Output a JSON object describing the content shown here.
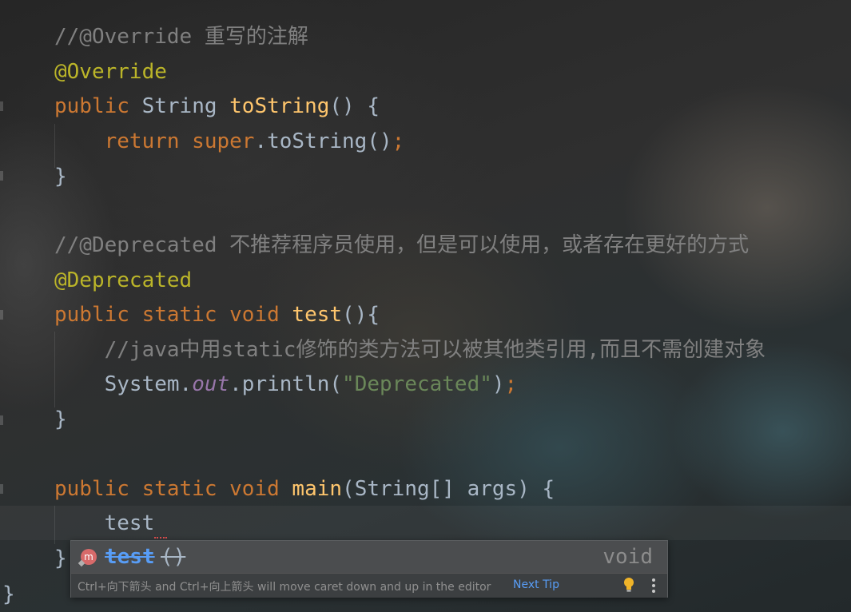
{
  "editor": {
    "lines": [
      {
        "tokens": [
          {
            "t": "//@Override 重写的注解",
            "c": "cm"
          }
        ]
      },
      {
        "tokens": [
          {
            "t": "@Override",
            "c": "ann"
          }
        ]
      },
      {
        "tokens": [
          {
            "t": "public ",
            "c": "kw"
          },
          {
            "t": "String ",
            "c": ""
          },
          {
            "t": "toString",
            "c": "fn"
          },
          {
            "t": "() {",
            "c": ""
          }
        ]
      },
      {
        "tokens": [
          {
            "t": "    return super",
            "c": "kw"
          },
          {
            "t": ".toString()",
            "c": ""
          },
          {
            "t": ";",
            "c": "semi"
          }
        ]
      },
      {
        "tokens": [
          {
            "t": "}",
            "c": ""
          }
        ]
      },
      {
        "tokens": []
      },
      {
        "tokens": [
          {
            "t": "//@Deprecated 不推荐程序员使用，但是可以使用，或者存在更好的方式",
            "c": "cm"
          }
        ]
      },
      {
        "tokens": [
          {
            "t": "@Deprecated",
            "c": "ann"
          }
        ]
      },
      {
        "tokens": [
          {
            "t": "public static void ",
            "c": "kw"
          },
          {
            "t": "test",
            "c": "fn"
          },
          {
            "t": "(){",
            "c": ""
          }
        ]
      },
      {
        "tokens": [
          {
            "t": "    //java中用static修饰的类方法可以被其他类引用,而且不需创建对象",
            "c": "cm"
          }
        ]
      },
      {
        "tokens": [
          {
            "t": "    System.",
            "c": ""
          },
          {
            "t": "out",
            "c": "field"
          },
          {
            "t": ".println(",
            "c": ""
          },
          {
            "t": "\"Deprecated\"",
            "c": "str"
          },
          {
            "t": ")",
            "c": ""
          },
          {
            "t": ";",
            "c": "semi"
          }
        ]
      },
      {
        "tokens": [
          {
            "t": "}",
            "c": ""
          }
        ]
      },
      {
        "tokens": []
      },
      {
        "tokens": [
          {
            "t": "public static void ",
            "c": "kw"
          },
          {
            "t": "main",
            "c": "fn"
          },
          {
            "t": "(String[] args) {",
            "c": ""
          }
        ]
      },
      {
        "tokens": [
          {
            "t": "    test",
            "c": ""
          }
        ]
      },
      {
        "tokens": [
          {
            "t": "}",
            "c": ""
          }
        ]
      }
    ],
    "closing_brace": "}"
  },
  "completion": {
    "icon": "method-icon",
    "icon_letter": "m",
    "item_name": "test",
    "item_params": "()",
    "item_type": "void",
    "tip_text": "Ctrl+向下箭头 and Ctrl+向上箭头 will move caret down and up in the editor",
    "next_tip_label": "Next Tip",
    "bulb_icon": "lightbulb-icon",
    "more_icon": "more-vertical-icon"
  }
}
